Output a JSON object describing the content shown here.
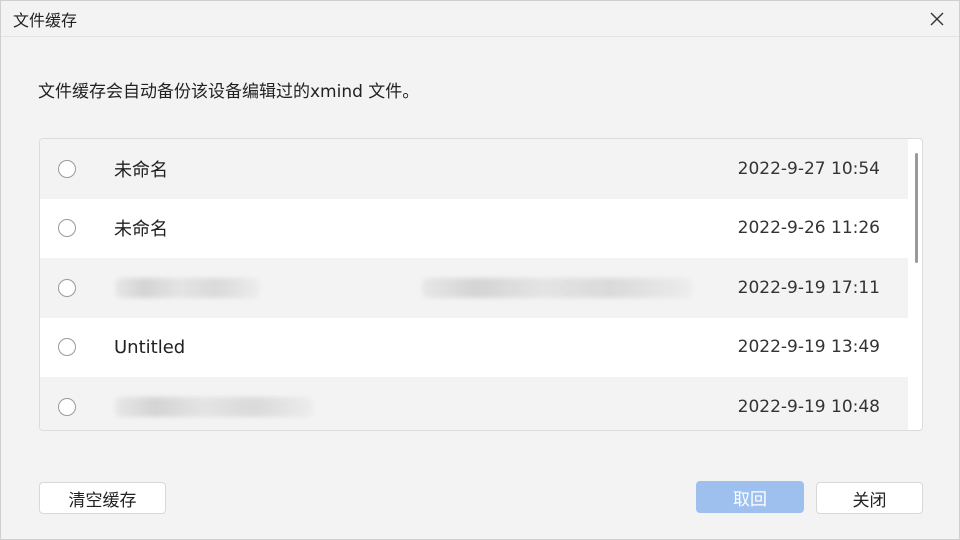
{
  "window": {
    "title": "文件缓存"
  },
  "description": "文件缓存会自动备份该设备编辑过的xmind 文件。",
  "files": [
    {
      "name": "未命名",
      "date": "2022-9-27 10:54"
    },
    {
      "name": "未命名",
      "date": "2022-9-26 11:26"
    },
    {
      "name": "",
      "date": "2022-9-19 17:11"
    },
    {
      "name": "Untitled",
      "date": "2022-9-19 13:49"
    },
    {
      "name": "",
      "date": "2022-9-19 10:48"
    }
  ],
  "buttons": {
    "clear": "清空缓存",
    "restore": "取回",
    "close": "关闭"
  },
  "colors": {
    "primary_disabled": "#9dc0ee",
    "row_alt": "#f3f3f3"
  },
  "icons": {
    "close": "close-icon"
  }
}
